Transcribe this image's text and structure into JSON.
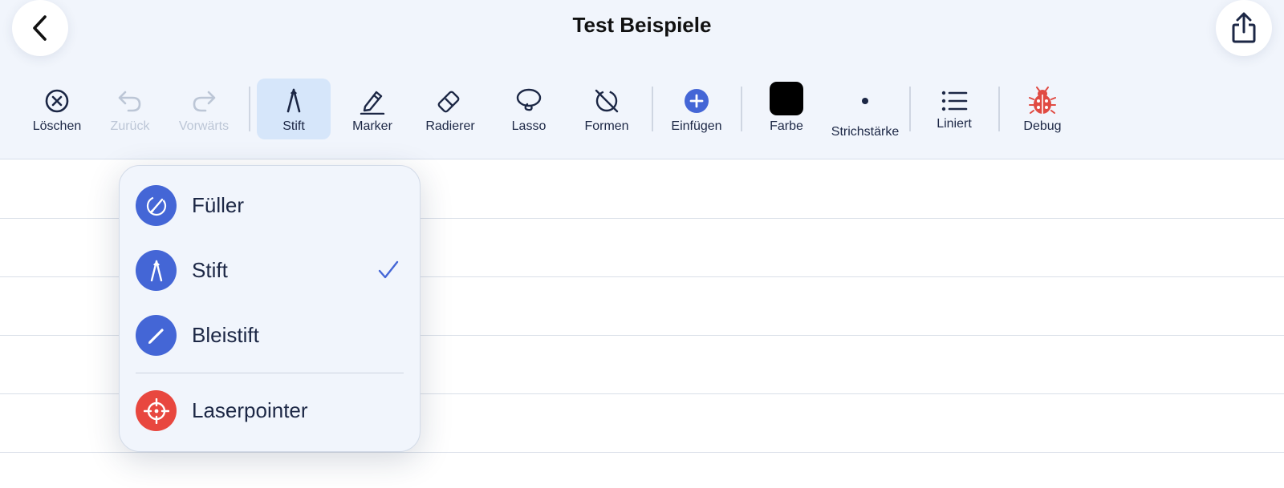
{
  "header": {
    "title": "Test Beispiele",
    "back_icon": "chevron-left-icon",
    "share_icon": "share-icon"
  },
  "toolbar": {
    "items": [
      {
        "label": "Löschen",
        "icon": "x-circle-icon",
        "disabled": false
      },
      {
        "label": "Zurück",
        "icon": "undo-icon",
        "disabled": true
      },
      {
        "label": "Vorwärts",
        "icon": "redo-icon",
        "disabled": true
      },
      {
        "label": "Stift",
        "icon": "pen-nib-icon",
        "active": true
      },
      {
        "label": "Marker",
        "icon": "marker-icon"
      },
      {
        "label": "Radierer",
        "icon": "eraser-icon"
      },
      {
        "label": "Lasso",
        "icon": "lasso-icon"
      },
      {
        "label": "Formen",
        "icon": "shapes-slash-icon"
      },
      {
        "label": "Einfügen",
        "icon": "plus-circle-icon"
      },
      {
        "label": "Farbe",
        "icon": "color-swatch",
        "value": "#000000"
      },
      {
        "label": "Strichstärke",
        "icon": "dot-icon"
      },
      {
        "label": "Liniert",
        "icon": "list-icon"
      },
      {
        "label": "Debug",
        "icon": "ladybug-icon"
      }
    ]
  },
  "pen_menu": {
    "items": [
      {
        "label": "Füller",
        "icon": "fountain-pen-icon",
        "selected": false
      },
      {
        "label": "Stift",
        "icon": "pen-nib-icon",
        "selected": true
      },
      {
        "label": "Bleistift",
        "icon": "pencil-icon",
        "selected": false
      },
      {
        "label": "Laserpointer",
        "icon": "crosshair-icon",
        "selected": false
      }
    ]
  },
  "colors": {
    "accent": "#4466d6",
    "laser": "#e8473f",
    "debug": "#e04b43",
    "text": "#1c2745",
    "toolbar_bg": "#f1f5fc"
  }
}
